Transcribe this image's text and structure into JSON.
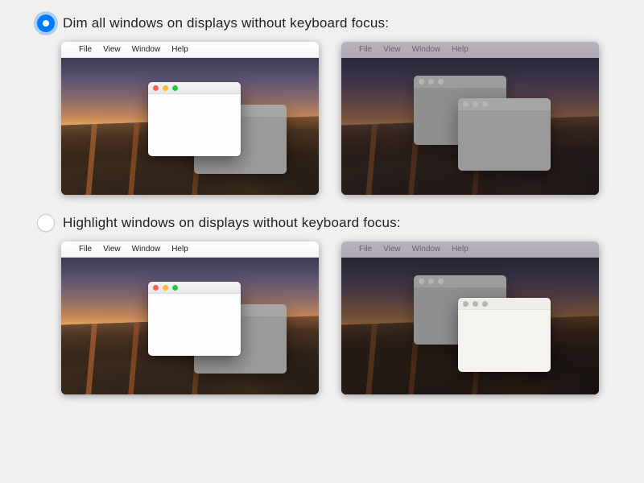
{
  "options": [
    {
      "label": "Dim all windows on displays without keyboard focus:",
      "selected": true
    },
    {
      "label": "Highlight windows on displays without keyboard focus:",
      "selected": false
    }
  ],
  "menubar": {
    "apple": "",
    "items": [
      "File",
      "View",
      "Window",
      "Help"
    ]
  },
  "colors": {
    "accent": "#007aff"
  }
}
